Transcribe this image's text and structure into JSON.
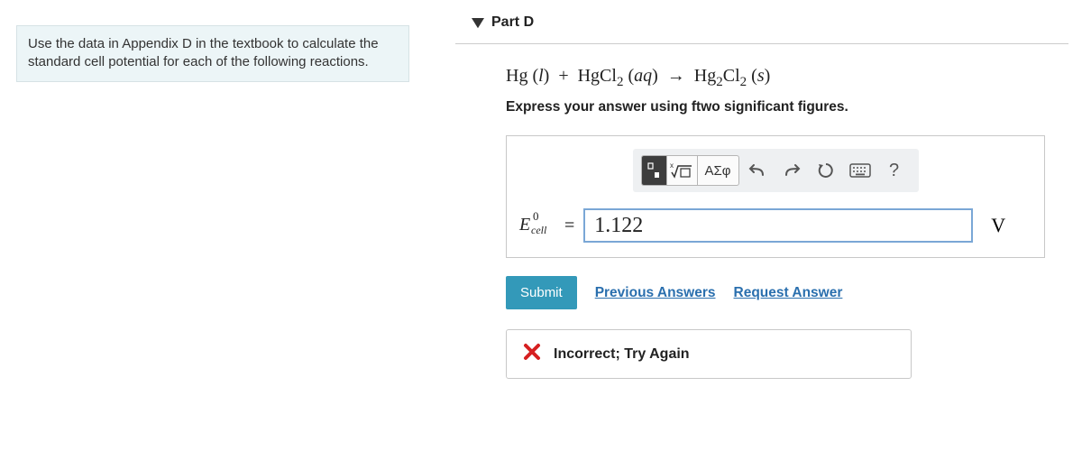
{
  "instructions": "Use the data in Appendix D in the textbook to calculate the standard cell potential for each of the following reactions.",
  "part": {
    "title": "Part D",
    "reaction_html": "Hg (<span class='state'>l</span>) &nbsp;+&nbsp; HgCl<sub>2</sub> (<span class='state'>aq</span>) &nbsp;→&nbsp; Hg<sub>2</sub>Cl<sub>2</sub> (<span class='state'>s</span>)",
    "instruction_line": "Express your answer using ftwo significant figures.",
    "toolbar": {
      "greek_label": "ΑΣφ"
    },
    "variable": {
      "E": "E",
      "sup": "0",
      "sub": "cell",
      "equals": "="
    },
    "answer_value": "1.122",
    "unit": "V",
    "submit": "Submit",
    "prev_answers": "Previous Answers",
    "request_answer": "Request Answer",
    "feedback": "Incorrect; Try Again"
  }
}
